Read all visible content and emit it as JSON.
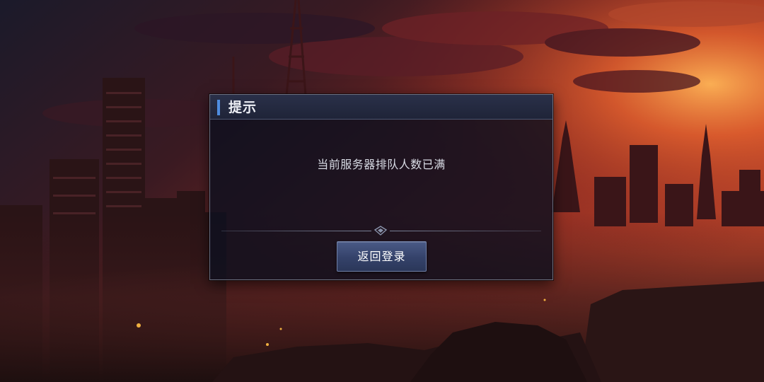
{
  "dialog": {
    "title": "提示",
    "message": "当前服务器排队人数已满",
    "button_label": "返回登录"
  },
  "colors": {
    "accent": "#4f8de0",
    "button": "#3b4a74",
    "dialog_bg": "#0d101e",
    "sky_glow": "#e0623a"
  },
  "background": {
    "scene": "sunset-ruined-city",
    "icon": "diamond-divider-icon"
  }
}
